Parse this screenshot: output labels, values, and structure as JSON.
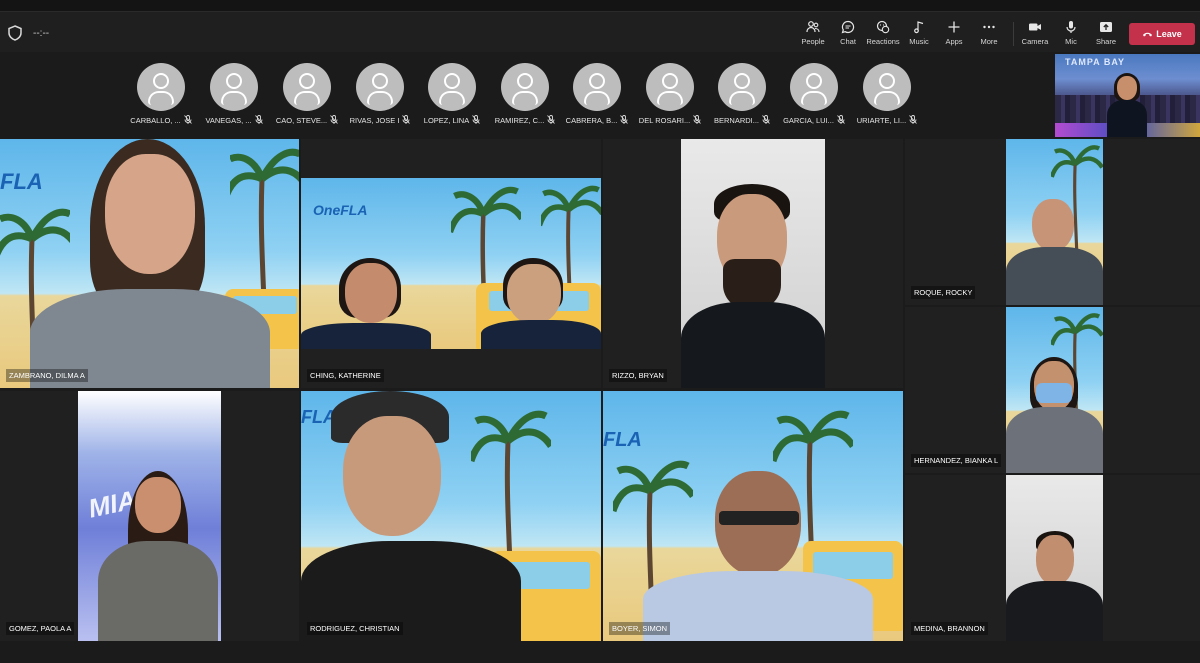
{
  "meeting": {
    "timer": "--:--"
  },
  "toolbar": {
    "people": "People",
    "chat": "Chat",
    "reactions": "Reactions",
    "music": "Music",
    "apps": "Apps",
    "more": "More",
    "camera": "Camera",
    "mic": "Mic",
    "share": "Share",
    "leave": "Leave"
  },
  "roster": [
    "CARBALLO, ...",
    "VANEGAS, ...",
    "CAO, STEVE...",
    "RIVAS, JOSE I",
    "LOPEZ, LINA",
    "RAMIREZ, C...",
    "CABRERA, B...",
    "DEL ROSARI...",
    "BERNARDI...",
    "GARCIA, LUI...",
    "URIARTE, LI..."
  ],
  "self_view": {
    "background_text": "TAMPA BAY"
  },
  "tiles": {
    "zambrano": {
      "name": "ZAMBRANO, DILMA A",
      "logo": "FLA"
    },
    "ching": {
      "name": "CHING, KATHERINE",
      "logo": "OneFLA"
    },
    "rizzo": {
      "name": "RIZZO, BRYAN"
    },
    "roque": {
      "name": "ROQUE, ROCKY"
    },
    "hernandez": {
      "name": "HERNANDEZ, BIANKA L"
    },
    "medina": {
      "name": "MEDINA, BRANNON"
    },
    "gomez": {
      "name": "GOMEZ, PAOLA A",
      "bg_text": "MIAMI"
    },
    "rodriguez": {
      "name": "RODRIGUEZ, CHRISTIAN",
      "logo": "FLA"
    },
    "boyer": {
      "name": "BOYER, SIMON",
      "logo": "FLA"
    }
  },
  "colors": {
    "leave": "#c4314b",
    "background": "#1b1b1b",
    "toolbar": "#1f1f1f",
    "avatar": "#bdbdbd"
  }
}
